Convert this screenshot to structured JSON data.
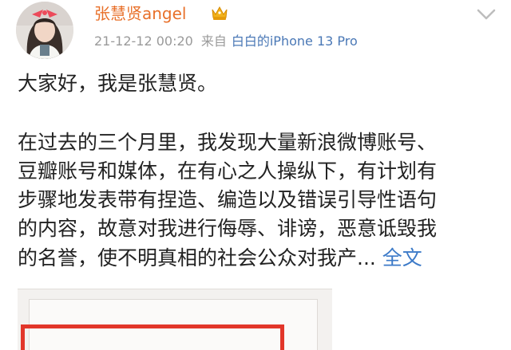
{
  "post": {
    "author": "张慧贤angel",
    "timestamp": "21-12-12 00:20",
    "source_label": "来自",
    "device": "白白的iPhone 13 Pro",
    "greeting": "大家好，我是张慧贤。",
    "body_lines": [
      "在过去的三个月里，我发现大量新浪微博账号、",
      "豆瓣账号和媒体，在有心之人操纵下，有计划有",
      "步骤地发表带有捏造、编造以及错误引导性语句",
      "的内容，故意对我进行侮辱、诽谤，恶意诋毁我",
      "的名誉，使不明真相的社会公众对我产..."
    ],
    "expand_label": "全文"
  },
  "icons": {
    "avatar": "avatar-photo",
    "badge": "crown-icon",
    "menu": "chevron-down-icon"
  },
  "colors": {
    "author": "#e8702a",
    "link": "#3c7ac8",
    "device": "#4a78b6",
    "meta": "#9a9a9a",
    "text": "#222222",
    "highlight_box": "#e2362a"
  }
}
